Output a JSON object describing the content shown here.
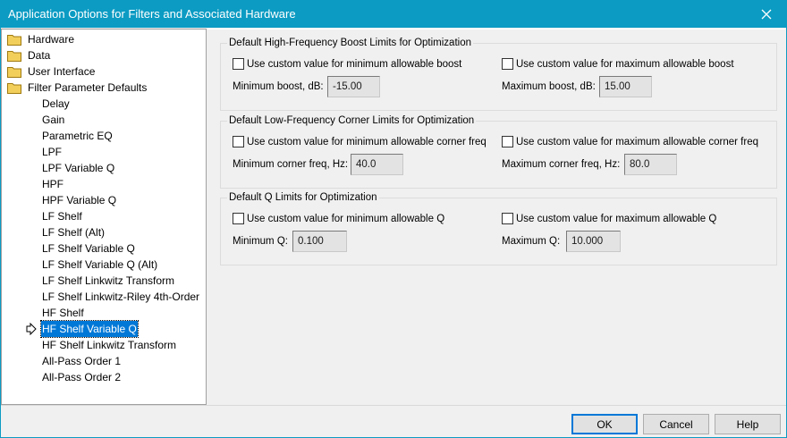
{
  "window": {
    "title": "Application Options for Filters and Associated Hardware"
  },
  "tree": {
    "folders": [
      "Hardware",
      "Data",
      "User Interface",
      "Filter Parameter Defaults"
    ],
    "children": [
      "Delay",
      "Gain",
      "Parametric EQ",
      "LPF",
      "LPF Variable Q",
      "HPF",
      "HPF Variable Q",
      "LF Shelf",
      "LF Shelf (Alt)",
      "LF Shelf Variable Q",
      "LF Shelf Variable Q (Alt)",
      "LF Shelf Linkwitz Transform",
      "LF Shelf Linkwitz-Riley 4th-Order",
      "HF Shelf",
      "HF Shelf Variable Q",
      "HF Shelf Linkwitz Transform",
      "All-Pass Order 1",
      "All-Pass Order 2"
    ],
    "selected": "HF Shelf Variable Q",
    "folder_color": "#f2cf5b",
    "selection_color": "#0078d7"
  },
  "groups": [
    {
      "title": "Default High-Frequency Boost Limits for Optimization",
      "min_checkbox": "Use custom value for minimum allowable boost",
      "max_checkbox": "Use custom value for maximum allowable boost",
      "min_label": "Minimum boost, dB:",
      "min_value": "-15.00",
      "max_label": "Maximum boost, dB:",
      "max_value": "15.00"
    },
    {
      "title": "Default Low-Frequency Corner Limits for Optimization",
      "min_checkbox": "Use custom value for minimum allowable corner freq",
      "max_checkbox": "Use custom value for maximum allowable corner freq",
      "min_label": "Minimum corner freq, Hz:",
      "min_value": "40.0",
      "max_label": "Maximum corner freq, Hz:",
      "max_value": "80.0"
    },
    {
      "title": "Default Q Limits for Optimization",
      "min_checkbox": "Use custom value for minimum allowable Q",
      "max_checkbox": "Use custom value for maximum allowable Q",
      "min_label": "Minimum Q:",
      "min_value": "0.100",
      "max_label": "Maximum Q:",
      "max_value": "10.000"
    }
  ],
  "buttons": {
    "ok": "OK",
    "cancel": "Cancel",
    "help": "Help"
  },
  "colors": {
    "title_bar": "#0b9bc3",
    "default_button_border": "#0078d7"
  }
}
